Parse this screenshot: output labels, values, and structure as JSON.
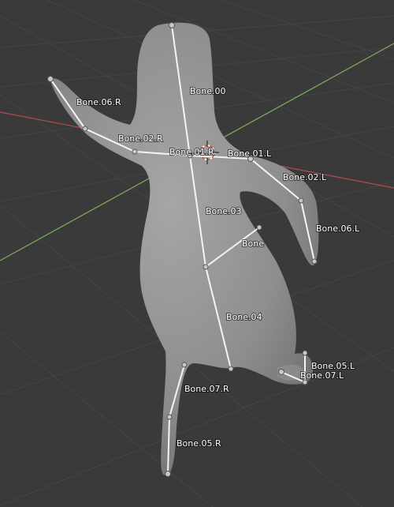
{
  "viewport": {
    "background_color": "#3a3a3a",
    "grid_color": "#454545",
    "x_axis_color": "#b64b4b",
    "y_axis_color": "#7fb35c",
    "mesh_color": "#9a9a9a",
    "bone_color": "#f0f0f0"
  },
  "bones": [
    {
      "name": "Bone.00"
    },
    {
      "name": "Bone.06.R"
    },
    {
      "name": "Bone.02.R"
    },
    {
      "name": "Bone.01.R"
    },
    {
      "name": "Bone.01.L"
    },
    {
      "name": "Bone.02.L"
    },
    {
      "name": "Bone.03"
    },
    {
      "name": "Bone.06.L"
    },
    {
      "name": "Bone"
    },
    {
      "name": "Bone.04"
    },
    {
      "name": "Bone.05.L"
    },
    {
      "name": "Bone.07.L"
    },
    {
      "name": "Bone.07.R"
    },
    {
      "name": "Bone.05.R"
    }
  ],
  "cursor_3d": {
    "icon": "3d-cursor-icon"
  }
}
